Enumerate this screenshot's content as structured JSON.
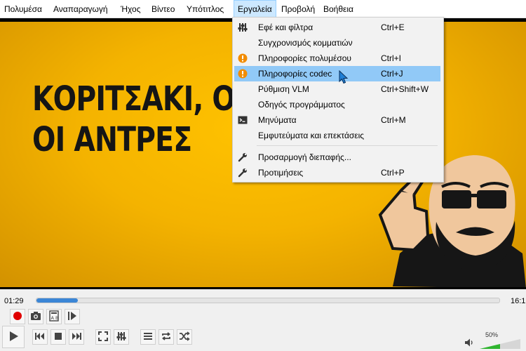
{
  "menubar": {
    "items": [
      "Πολυμέσα",
      "Αναπαραγωγή",
      "Ήχος",
      "Βίντεο",
      "Υπότιτλος",
      "Εργαλεία",
      "Προβολή",
      "Βοήθεια"
    ]
  },
  "video": {
    "line1": "ΚΟΡΙΤΣΑΚΙ, Ο",
    "line2": "ΟΙ ΑΝΤΡΕΣ"
  },
  "tools_menu": {
    "items": [
      {
        "label": "Εφέ και φίλτρα",
        "shortcut": "Ctrl+E",
        "icon": "sliders-icon"
      },
      {
        "label": "Συγχρονισμός κομματιών",
        "shortcut": "",
        "icon": ""
      },
      {
        "label": "Πληροφορίες πολυμέσου",
        "shortcut": "Ctrl+I",
        "icon": "info-icon"
      },
      {
        "label": "Πληροφορίες codec",
        "shortcut": "Ctrl+J",
        "icon": "info-icon"
      },
      {
        "label": "Ρύθμιση VLM",
        "shortcut": "Ctrl+Shift+W",
        "icon": ""
      },
      {
        "label": "Οδηγός προγράμματος",
        "shortcut": "",
        "icon": ""
      },
      {
        "label": "Μηνύματα",
        "shortcut": "Ctrl+M",
        "icon": "terminal-icon"
      },
      {
        "label": "Εμφυτεύματα και επεκτάσεις",
        "shortcut": "",
        "icon": ""
      },
      {
        "label": "Προσαρμογή διεπαφής...",
        "shortcut": "",
        "icon": "wrench-icon"
      },
      {
        "label": "Προτιμήσεις",
        "shortcut": "Ctrl+P",
        "icon": "wrench-icon"
      }
    ]
  },
  "player": {
    "elapsed": "01:29",
    "total": "16:1",
    "progress": 0.09,
    "volume_label": "50%",
    "volume": 0.5
  },
  "colors": {
    "accent": "#3b86d6",
    "highlight": "#91c9f7",
    "video_bg": "#f4b300"
  }
}
